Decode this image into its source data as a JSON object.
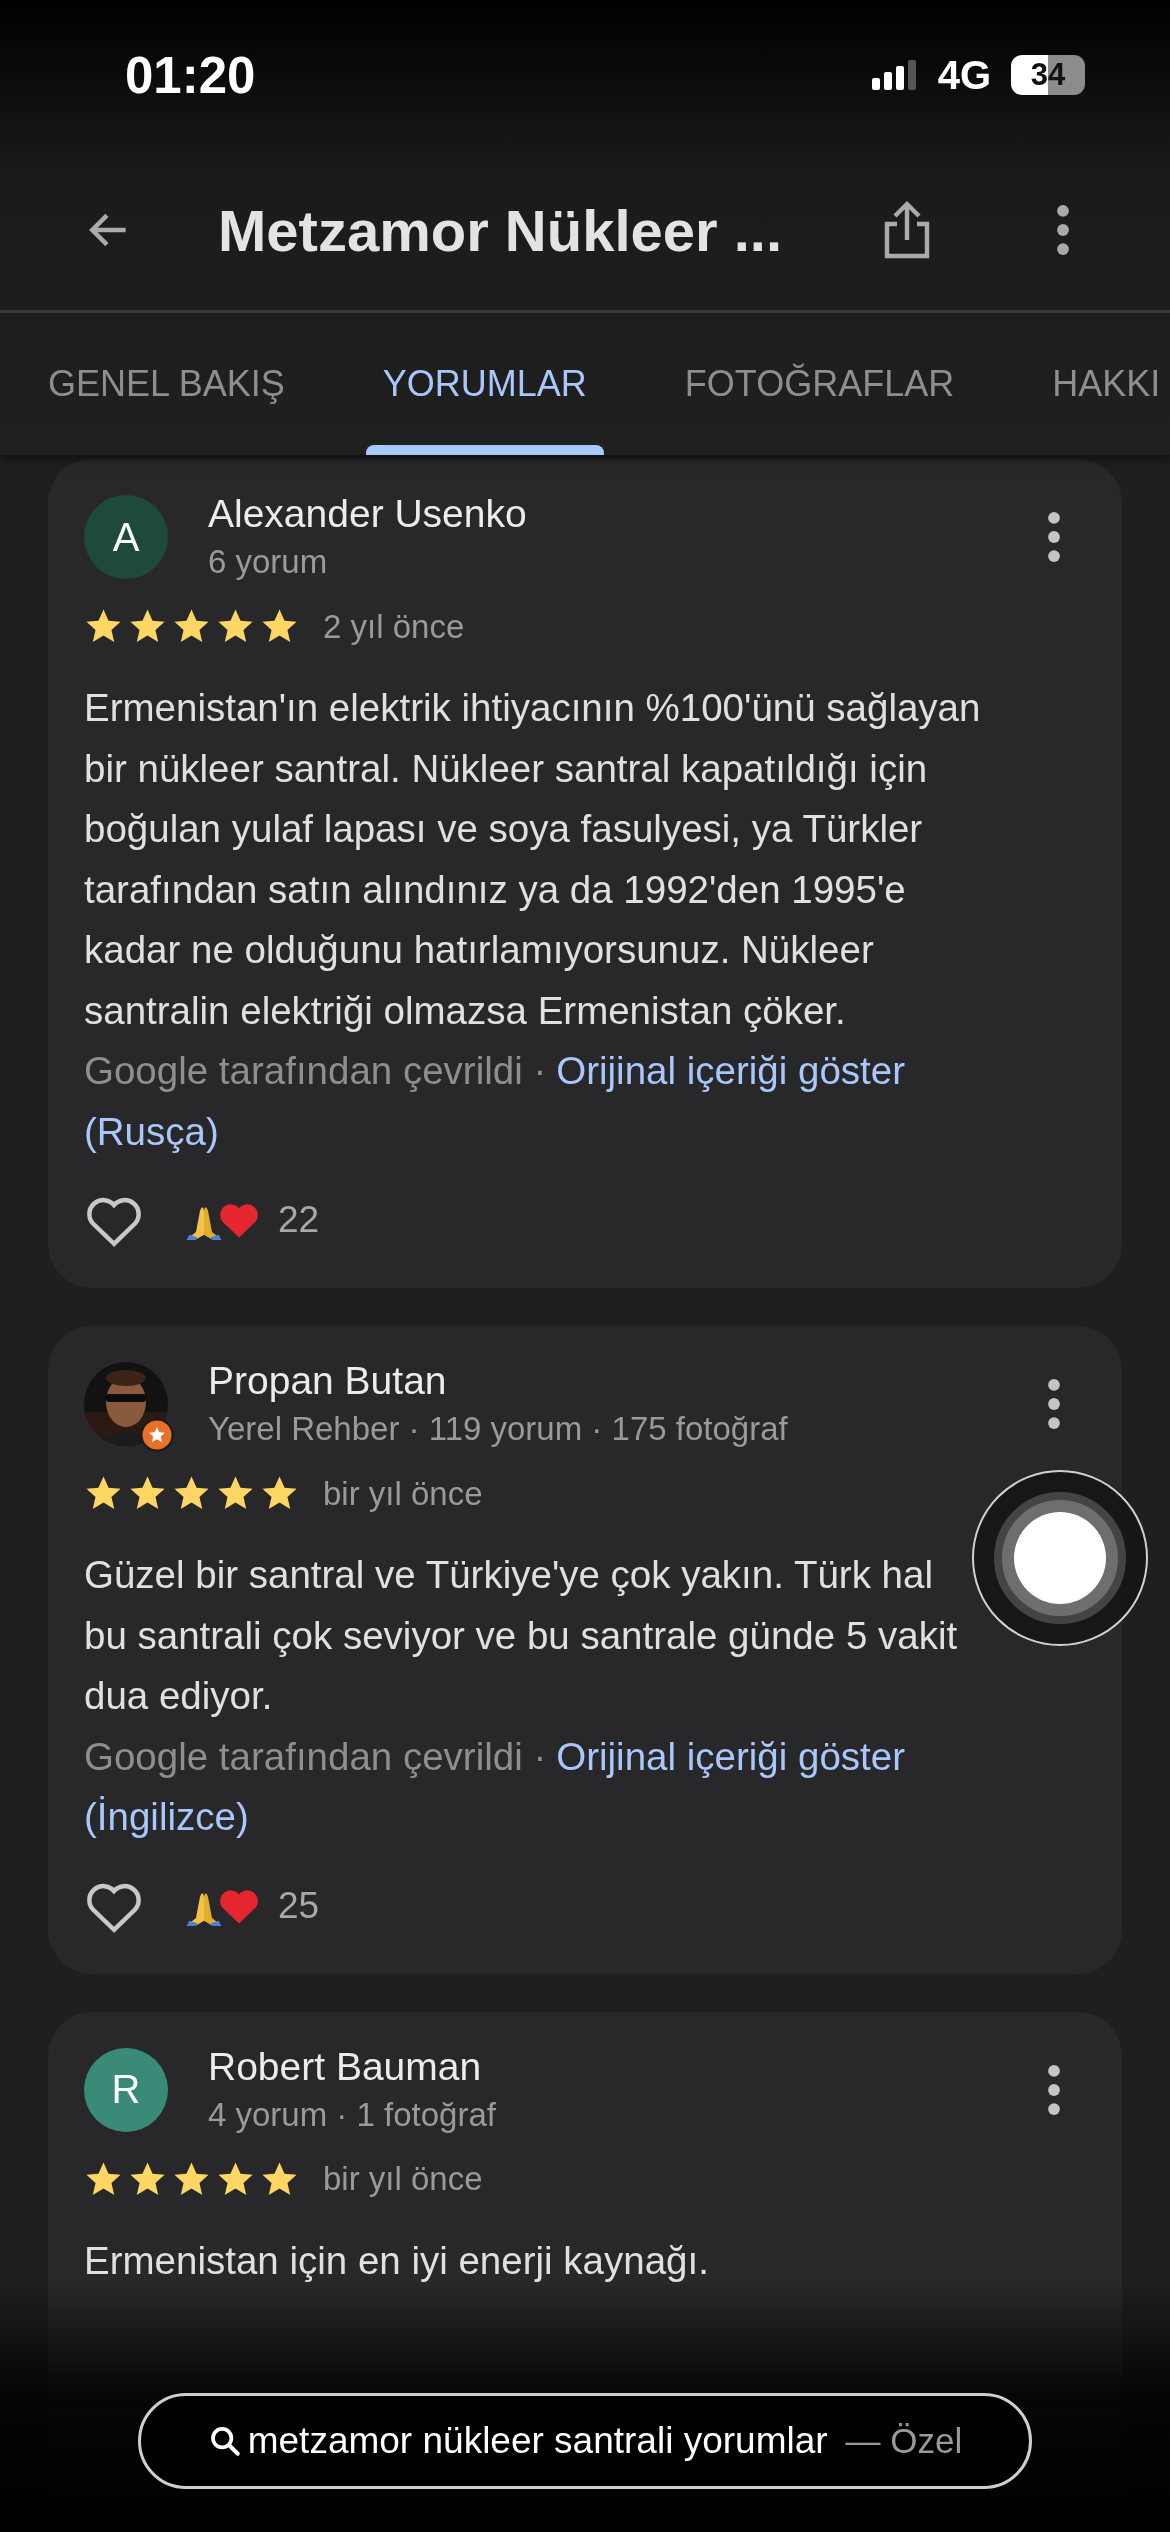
{
  "status_bar": {
    "time": "01:20",
    "network": "4G",
    "battery": "34"
  },
  "app_bar": {
    "title": "Metzamor Nükleer ..."
  },
  "tabs": [
    {
      "label": "GENEL BAKIŞ",
      "selected": false
    },
    {
      "label": "YORUMLAR",
      "selected": true
    },
    {
      "label": "FOTOĞRAFLAR",
      "selected": false
    },
    {
      "label": "HAKKI",
      "selected": false
    }
  ],
  "reviews": [
    {
      "avatar": {
        "kind": "letter",
        "letter": "A",
        "color": "#1e4a3a"
      },
      "name": "Alexander Usenko",
      "meta": "6 yorum",
      "stars": 5,
      "time": "2 yıl önce",
      "lines": [
        "Ermenistan'ın elektrik ihtiyacının %100'ünü sağlayan",
        "bir nükleer santral. Nükleer santral kapatıldığı için",
        "boğulan yulaf lapası ve soya fasulyesi, ya Türkler",
        "tarafından satın alındınız ya da 1992'den 1995'e",
        "kadar ne olduğunu hatırlamıyorsunuz. Nükleer",
        "santralin elektriği olmazsa Ermenistan çöker."
      ],
      "translation": {
        "note": "Google tarafından çevrildi ·",
        "link": "Orijinal içeriği göster",
        "language": "(Rusça)"
      },
      "reaction_count": "22"
    },
    {
      "avatar": {
        "kind": "picture",
        "badge": true
      },
      "name": "Propan Butan",
      "meta": "Yerel Rehber · 119 yorum · 175 fotoğraf",
      "stars": 5,
      "time": "bir yıl önce",
      "lines": [
        "Güzel bir santral ve Türkiye'ye çok yakın. Türk hal",
        "bu santrali çok seviyor ve bu santrale günde 5 vakit",
        "dua ediyor."
      ],
      "translation": {
        "note": "Google tarafından çevrildi ·",
        "link": "Orijinal içeriği göster",
        "language": "(İngilizce)"
      },
      "reaction_count": "25"
    },
    {
      "avatar": {
        "kind": "letter",
        "letter": "R",
        "color": "#3a8a78"
      },
      "name": "Robert Bauman",
      "meta": "4 yorum · 1 fotoğraf",
      "stars": 5,
      "time": "bir yıl önce",
      "lines": [
        "Ermenistan için en iyi enerji kaynağı."
      ]
    }
  ],
  "search_pill": {
    "query": "metzamor nükleer santrali yorumlar",
    "mode": "— Özel"
  }
}
